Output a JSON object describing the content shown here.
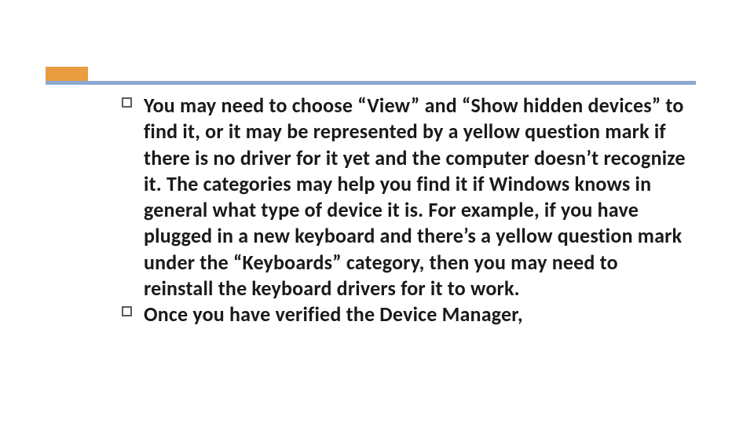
{
  "colors": {
    "accent": "#ea9c41",
    "divider": "#8ba8d0",
    "bullet_border": "#5b5b5b",
    "text": "#1a1a1a"
  },
  "bullets": [
    {
      "text": "You may need to choose “View” and “Show hidden devices” to find it, or it may be represented by a yellow question mark if there is no driver for it yet and the computer doesn’t recognize it. The categories may help you find it if Windows knows in general what type of device it is. For example, if you have plugged in a new keyboard and there’s a yellow question mark under the “Keyboards” category, then you may need to reinstall the keyboard drivers for it to work."
    },
    {
      "text": "Once you have verified the Device Manager,"
    }
  ]
}
